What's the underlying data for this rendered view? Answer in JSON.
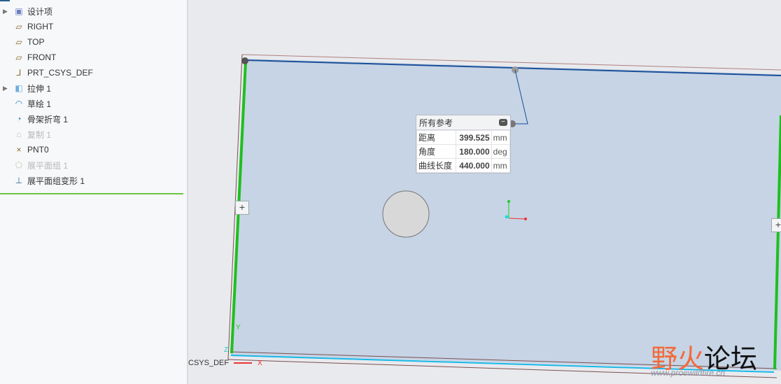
{
  "tree": [
    {
      "label": "设计项",
      "icon": "design-items-icon",
      "expand": true,
      "dim": false
    },
    {
      "label": "RIGHT",
      "icon": "datum-plane-icon",
      "expand": false,
      "dim": false
    },
    {
      "label": "TOP",
      "icon": "datum-plane-icon",
      "expand": false,
      "dim": false
    },
    {
      "label": "FRONT",
      "icon": "datum-plane-icon",
      "expand": false,
      "dim": false
    },
    {
      "label": "PRT_CSYS_DEF",
      "icon": "csys-icon",
      "expand": false,
      "dim": false
    },
    {
      "label": "拉伸 1",
      "icon": "extrude-icon",
      "expand": true,
      "dim": false
    },
    {
      "label": "草绘 1",
      "icon": "sketch-icon",
      "expand": false,
      "dim": false
    },
    {
      "label": "骨架折弯 1",
      "icon": "spinal-bend-icon",
      "expand": false,
      "dim": false
    },
    {
      "label": "复制 1",
      "icon": "copy-icon",
      "expand": false,
      "dim": true
    },
    {
      "label": "PNT0",
      "icon": "datum-point-icon",
      "expand": false,
      "dim": false
    },
    {
      "label": "展平面组 1",
      "icon": "flatten-quilt-icon",
      "expand": false,
      "dim": true
    },
    {
      "label": "展平面组变形 1",
      "icon": "flatten-deform-icon",
      "expand": false,
      "dim": false
    }
  ],
  "refbox": {
    "title": "所有参考",
    "rows": [
      {
        "label": "距离",
        "value": "399.525",
        "unit": "mm"
      },
      {
        "label": "角度",
        "value": "180.000",
        "unit": "deg"
      },
      {
        "label": "曲线长度",
        "value": "440.000",
        "unit": "mm"
      }
    ]
  },
  "viewport": {
    "csys_label": "CSYS_DEF",
    "axis_x": "X",
    "axis_y": "Y",
    "axis_z": "Z",
    "plus": "+"
  },
  "watermark": {
    "a": "野火",
    "b": "论坛",
    "url": "www.proewildfire.cn"
  }
}
